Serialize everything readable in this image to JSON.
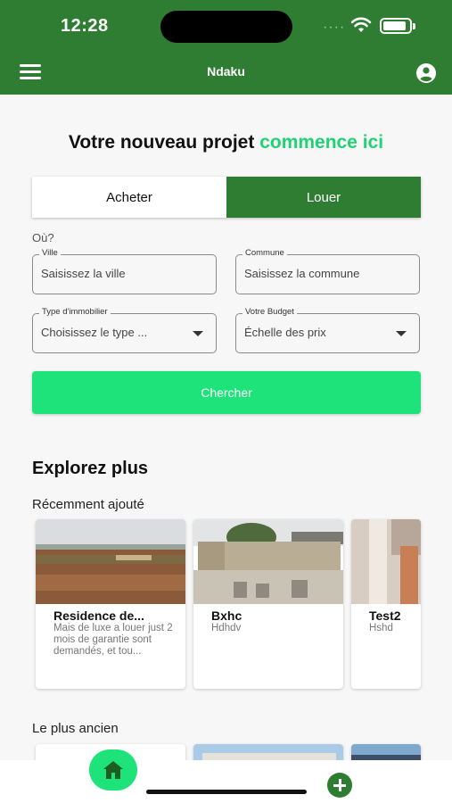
{
  "status_bar": {
    "time": "12:28",
    "dots": "····"
  },
  "app_bar": {
    "title": "Ndaku",
    "menu_icon": "menu-icon",
    "account_icon": "account-circle-icon"
  },
  "hero": {
    "title_part1": "Votre nouveau projet",
    "title_accent": "commence ici"
  },
  "mode_toggle": {
    "buy_label": "Acheter",
    "rent_label": "Louer",
    "selected": "Louer"
  },
  "search": {
    "where_label": "Où?",
    "city": {
      "label": "Ville",
      "placeholder": "Saisissez la ville"
    },
    "commune": {
      "label": "Commune",
      "placeholder": "Saisissez la commune"
    },
    "property_type": {
      "label": "Type d'immobilier",
      "value": "Choisissez le type ..."
    },
    "budget": {
      "label": "Votre Budget",
      "value": "Échelle des prix"
    },
    "submit_label": "Chercher"
  },
  "explore": {
    "title": "Explorez plus",
    "recent_title": "Récemment ajouté",
    "oldest_title": "Le plus ancien",
    "recent_items": [
      {
        "title": "Residence de...",
        "description": "Mais de luxe a louer just 2 mois de garantie sont demandés, et tou..."
      },
      {
        "title": "Bxhc",
        "description": "Hdhdv"
      },
      {
        "title": "Test2",
        "description": "Hshd"
      }
    ]
  },
  "bottom_nav": {
    "home_icon": "home-icon",
    "add_icon": "add-icon"
  },
  "colors": {
    "primary": "#2e7d32",
    "accent": "#1ee37a",
    "accent_text": "#1fd372"
  }
}
